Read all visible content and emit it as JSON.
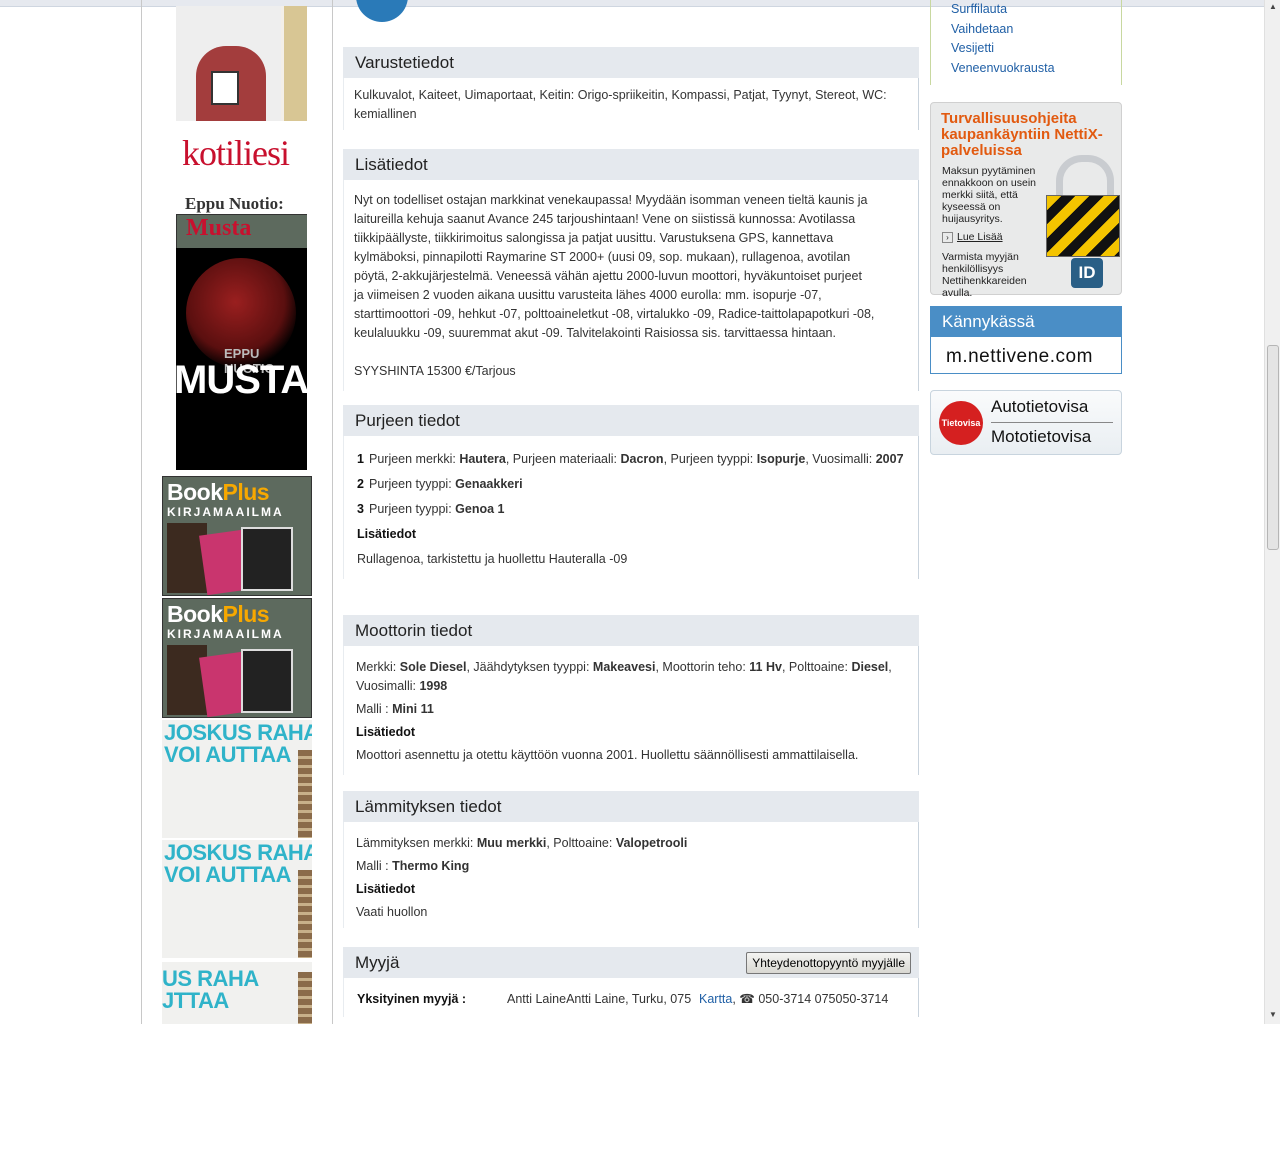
{
  "equipment": {
    "title": "Varustetiedot",
    "text": "Kulkuvalot, Kaiteet, Uimaportaat, Keitin: Origo-spriikeitin, Kompassi, Patjat, Tyynyt, Stereot, WC: kemiallinen"
  },
  "extra": {
    "title": "Lisätiedot",
    "lines": [
      "Nyt on todelliset ostajan markkinat venekaupassa! Myydään isomman veneen tieltä kaunis ja",
      "laitureilla kehuja saanut Avance 245 tarjoushintaan! Vene on siistissä kunnossa: Avotilassa",
      "tiikkipäällyste, tiikkirimoitus salongissa ja patjat uusittu. Varustuksena GPS, kannettava",
      "kylmäboksi, pinnapilotti Raymarine ST 2000+ (uusi 09, sop. mukaan), rullagenoa, avotilan",
      "pöytä, 2-akkujärjestelmä. Veneessä vähän ajettu 2000-luvun moottori, hyväkuntoiset purjeet",
      "ja viimeisen 2 vuoden aikana uusittu varusteita lähes 4000 eurolla: mm. isopurje -07,",
      "starttimoottori -09, hehkut -07, polttoaineletkut -08, virtalukko -09, Radice-taittolapapotkuri -08,",
      "keulaluukku -09, suuremmat akut -09. Talvitelakointi Raisiossa sis. tarvittaessa hintaan."
    ],
    "price": "SYYSHINTA 15300 €/Tarjous"
  },
  "sails": {
    "title": "Purjeen tiedot",
    "s1_num": "1",
    "s1_brand_label": "Purjeen merkki: ",
    "s1_brand": "Hautera",
    "s1_material_label": ", Purjeen materiaali: ",
    "s1_material": "Dacron",
    "s1_type_label": ", Purjeen tyyppi: ",
    "s1_type": "Isopurje",
    "s1_year_label": ", Vuosimalli: ",
    "s1_year": "2007",
    "s2_num": "2",
    "s2_type_label": "Purjeen tyyppi: ",
    "s2_type": "Genaakkeri",
    "s3_num": "3",
    "s3_type_label": "Purjeen tyyppi: ",
    "s3_type": "Genoa 1",
    "extra_label": "Lisätiedot",
    "extra_text": "Rullagenoa, tarkistettu ja huollettu Hauteralla -09"
  },
  "engine": {
    "title": "Moottorin tiedot",
    "brand_label": "Merkki: ",
    "brand": "Sole Diesel",
    "cooling_label": ", Jäähdytyksen tyyppi: ",
    "cooling": "Makeavesi",
    "power_label": ", Moottorin teho: ",
    "power": "11 Hv",
    "fuel_label": ", Polttoaine: ",
    "fuel": "Diesel",
    "year_label": ", Vuosimalli: ",
    "year": "1998",
    "model_label": "Malli : ",
    "model": "Mini 11",
    "extra_label": "Lisätiedot",
    "extra_text": "Moottori asennettu ja otettu käyttöön vuonna 2001. Huollettu säännöllisesti ammattilaisella."
  },
  "heating": {
    "title": "Lämmityksen tiedot",
    "brand_label": "Lämmityksen merkki: ",
    "brand": "Muu merkki",
    "fuel_label": ", Polttoaine: ",
    "fuel": "Valopetrooli",
    "model_label": "Malli : ",
    "model": "Thermo King",
    "extra_label": "Lisätiedot",
    "extra_text": "Vaati huollon"
  },
  "seller": {
    "title": "Myyjä",
    "contact_button": "Yhteydenottopyyntö myyjälle",
    "type_label": "Yksityinen myyjä :",
    "name_location": "Antti LaineAntti Laine, Turku, 075",
    "map_link": "Kartta",
    "phone": ", ☎ 050-3714 075050-3714"
  },
  "right": {
    "links": [
      "Surffilauta",
      "Vaihdetaan",
      "Vesijetti",
      "Veneenvuokrausta"
    ],
    "safety_title": "Turvallisuusohjeita kaupankäyntiin NettiX-palveluissa",
    "safety_body": "Maksun pyytäminen ennakkoon on usein merkki siitä, että kyseessä on huijausyritys.",
    "safety_more": "Lue Lisää",
    "safety_body2": "Varmista myyjän henkilöllisyys Nettihenkkareiden avulla.",
    "safety_id": "ID",
    "mobile_title": "Kännykässä",
    "mobile_url": "m.nettivene.com",
    "quiz_badge": "Tietovisa",
    "quiz_1": "Autotietovisa",
    "quiz_2": "Mototietovisa"
  },
  "ads": {
    "kotiliesi_logo": "kotiliesi",
    "kotiliesi_author": "Eppu Nuotio:",
    "kotiliesi_book": "Musta",
    "cover_author": "EPPU NUOTIO",
    "cover_title": "MUSTA",
    "book_brand_a": "Book",
    "book_brand_b": "Plus",
    "book_sub": "KIRJAMAAILMA",
    "joskus_1": "JOSKUS RAHA",
    "joskus_2": "VOI AUTTAA",
    "joskus3_1": "US RAHA",
    "joskus3_2": "JTTAA"
  },
  "colors": {
    "section_header_bg": "#e5e9ee",
    "link": "#2160a6",
    "accent_orange": "#e25a10",
    "mobile_blue": "#4a8ec6"
  }
}
